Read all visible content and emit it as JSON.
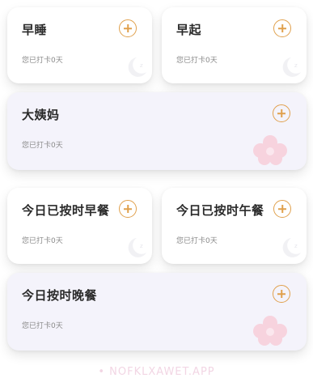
{
  "cards": [
    {
      "title": "早睡",
      "subtitle": "您已打卡0天",
      "icon": "moon-icon"
    },
    {
      "title": "早起",
      "subtitle": "您已打卡0天",
      "icon": "moon-icon"
    },
    {
      "title": "大姨妈",
      "subtitle": "您已打卡0天",
      "icon": "flower-icon"
    },
    {
      "title": "今日已按时早餐",
      "subtitle": "您已打卡0天",
      "icon": "moon-icon"
    },
    {
      "title": "今日已按时午餐",
      "subtitle": "您已打卡0天",
      "icon": "moon-icon"
    },
    {
      "title": "今日按时晚餐",
      "subtitle": "您已打卡0天",
      "icon": "flower-icon"
    }
  ],
  "add_icon": "plus-circle-icon",
  "watermark": "• NOFKLXAWET.APP",
  "colors": {
    "accent": "#e0a04c",
    "wide_card_bg": "#f4f3fb",
    "flower": "#f7d3de"
  }
}
